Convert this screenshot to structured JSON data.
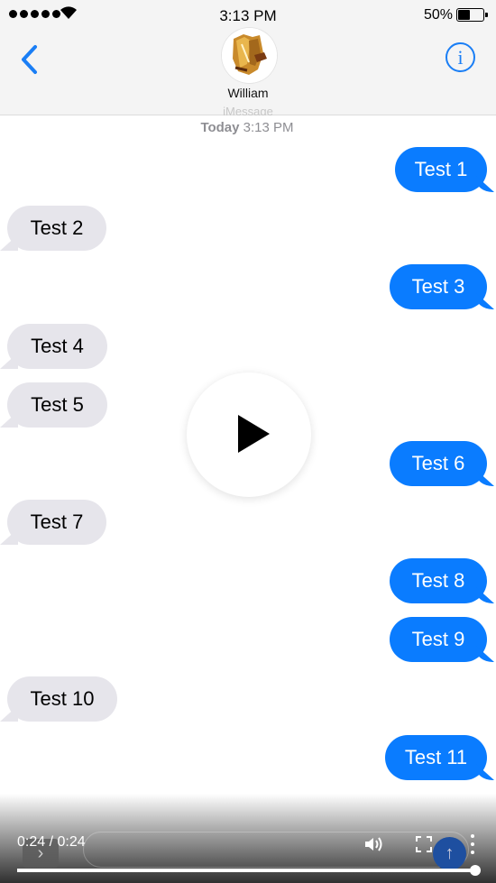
{
  "status_bar": {
    "time": "3:13 PM",
    "battery": "50%",
    "battery_level": 0.5
  },
  "header": {
    "contact_name": "William",
    "service_label": "iMessage",
    "info_label": "i"
  },
  "timestamp": {
    "day": "Today",
    "time": "3:13 PM"
  },
  "messages": [
    {
      "text": "Test 1",
      "direction": "outgoing"
    },
    {
      "text": "Test 2",
      "direction": "incoming"
    },
    {
      "text": "Test 3",
      "direction": "outgoing"
    },
    {
      "text": "Test 4",
      "direction": "incoming"
    },
    {
      "text": "Test 5",
      "direction": "incoming"
    },
    {
      "text": "Test 6",
      "direction": "outgoing"
    },
    {
      "text": "Test 7",
      "direction": "incoming"
    },
    {
      "text": "Test 8",
      "direction": "outgoing"
    },
    {
      "text": "Test 9",
      "direction": "outgoing"
    },
    {
      "text": "Test 10",
      "direction": "incoming"
    },
    {
      "text": "Test 11",
      "direction": "outgoing"
    }
  ],
  "video_player": {
    "time_display": "0:24 / 0:24",
    "progress": 1.0
  },
  "colors": {
    "accent": "#1a7ef5",
    "outgoing_bubble": "#0a7cff",
    "incoming_bubble": "#e6e5eb",
    "header_bg": "#f4f4f4"
  }
}
